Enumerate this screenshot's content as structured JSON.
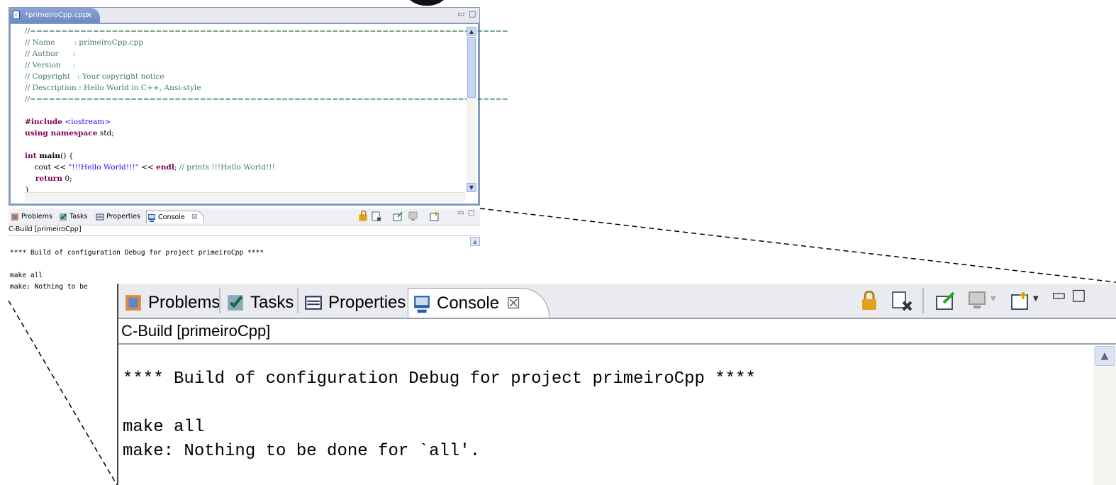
{
  "editor": {
    "tab_label": "*primeiroCpp.cpp",
    "tab_close": "✕",
    "code_lines": [
      {
        "type": "cmt",
        "text": "//============================================================================"
      },
      {
        "type": "cmt",
        "text": "// Name        : primeiroCpp.cpp"
      },
      {
        "type": "cmt",
        "text": "// Author      :"
      },
      {
        "type": "cmt",
        "text": "// Version     :"
      },
      {
        "type": "cmt",
        "text": "// Copyright   : Your copyright notice"
      },
      {
        "type": "cmt",
        "text": "// Description : Hello World in C++, Ansi-style"
      },
      {
        "type": "cmt",
        "text": "//============================================================================"
      },
      {
        "type": "blank",
        "text": ""
      },
      {
        "type": "include",
        "kw": "#include",
        "rest": " <iostream>"
      },
      {
        "type": "using",
        "kw": "using namespace",
        "rest": " std;"
      },
      {
        "type": "blank",
        "text": ""
      },
      {
        "type": "main",
        "kw": "int",
        "fn": " main",
        "rest": "() {"
      },
      {
        "type": "cout",
        "pre": "    cout << ",
        "str": "\"!!!Hello World!!!\"",
        "mid": " << ",
        "kw": "endl",
        "post": "; ",
        "cmt": "// prints !!!Hello World!!!"
      },
      {
        "type": "ret",
        "kw": "    return",
        "rest": " 0;"
      },
      {
        "type": "plain",
        "text": "}"
      }
    ]
  },
  "console_small": {
    "tabs": [
      {
        "label": "Problems",
        "icon": "problems-icon"
      },
      {
        "label": "Tasks",
        "icon": "tasks-icon"
      },
      {
        "label": "Properties",
        "icon": "properties-icon"
      },
      {
        "label": "Console",
        "icon": "console-icon",
        "close": "☒"
      }
    ],
    "subtitle": "C-Build [primeiroCpp]",
    "lines": [
      "**** Build of configuration Debug for project primeiroCpp ****",
      "",
      "make all",
      "make: Nothing to be"
    ]
  },
  "console_zoom": {
    "tabs": [
      {
        "label": "Problems",
        "icon": "problems-icon"
      },
      {
        "label": "Tasks",
        "icon": "tasks-icon"
      },
      {
        "label": "Properties",
        "icon": "properties-icon"
      },
      {
        "label": "Console",
        "icon": "console-icon",
        "close": "☒"
      }
    ],
    "subtitle": "C-Build [primeiroCpp]",
    "lines": [
      "**** Build of configuration Debug for project primeiroCpp ****",
      "",
      "make all",
      "make: Nothing to be done for `all'."
    ]
  },
  "window_controls": {
    "minimize": "▭",
    "maximize": "□"
  },
  "colors": {
    "comment": "#3f7f5f",
    "keyword": "#7f0055",
    "string": "#2a00ff",
    "tab_active": "#6c8ac4"
  }
}
